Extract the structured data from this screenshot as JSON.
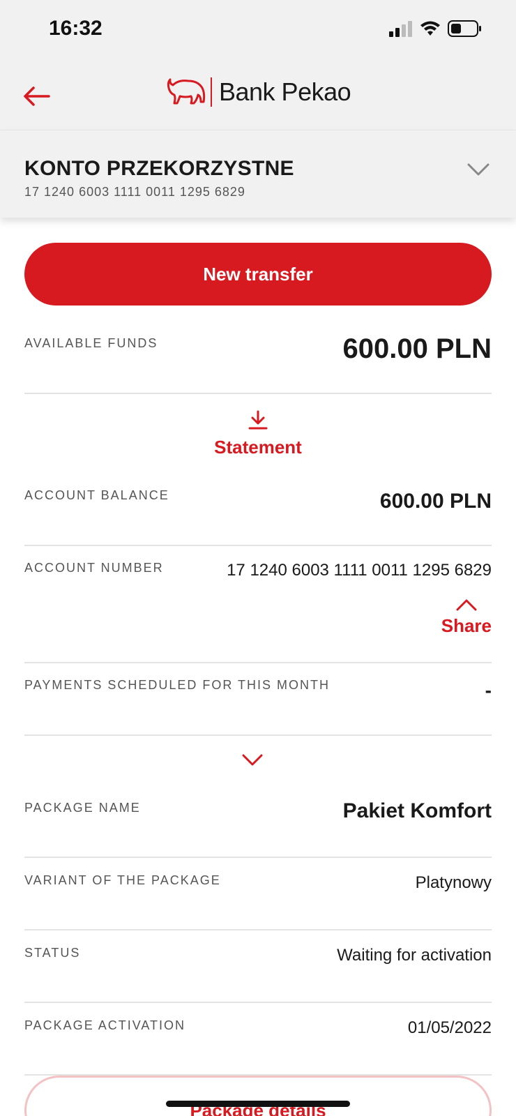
{
  "status_bar": {
    "time": "16:32"
  },
  "header": {
    "brand_name": "Bank Pekao"
  },
  "account": {
    "name": "KONTO PRZEKORZYSTNE",
    "number": "17 1240 6003 1111 0011 1295 6829"
  },
  "actions": {
    "new_transfer": "New transfer",
    "statement": "Statement",
    "share": "Share",
    "package_details": "Package details"
  },
  "details": {
    "available_funds": {
      "label": "AVAILABLE FUNDS",
      "value": "600.00 PLN"
    },
    "account_balance": {
      "label": "ACCOUNT BALANCE",
      "value": "600.00 PLN"
    },
    "account_number": {
      "label": "ACCOUNT NUMBER",
      "value": "17 1240 6003 1111 0011 1295 6829"
    },
    "payments_scheduled": {
      "label": "PAYMENTS SCHEDULED FOR THIS MONTH",
      "value": "-"
    },
    "package_name": {
      "label": "PACKAGE NAME",
      "value": "Pakiet Komfort"
    },
    "package_variant": {
      "label": "VARIANT OF THE PACKAGE",
      "value": "Platynowy"
    },
    "status": {
      "label": "STATUS",
      "value": "Waiting for activation"
    },
    "package_activation": {
      "label": "PACKAGE ACTIVATION",
      "value": "01/05/2022"
    }
  },
  "colors": {
    "brand_red": "#d71920",
    "panel_gray": "#f1f1f1"
  }
}
